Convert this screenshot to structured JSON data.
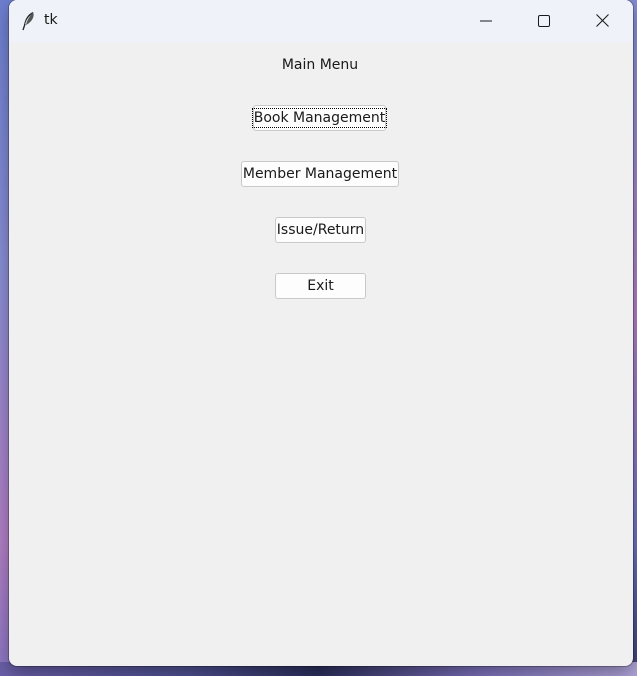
{
  "window": {
    "title": "tk",
    "app_icon": "feather-icon",
    "controls": [
      "minimize-icon",
      "maximize-icon",
      "close-icon"
    ]
  },
  "main": {
    "title": "Main Menu",
    "buttons": {
      "book": "Book Management",
      "member": "Member Management",
      "issue": "Issue/Return",
      "exit": "Exit"
    }
  }
}
